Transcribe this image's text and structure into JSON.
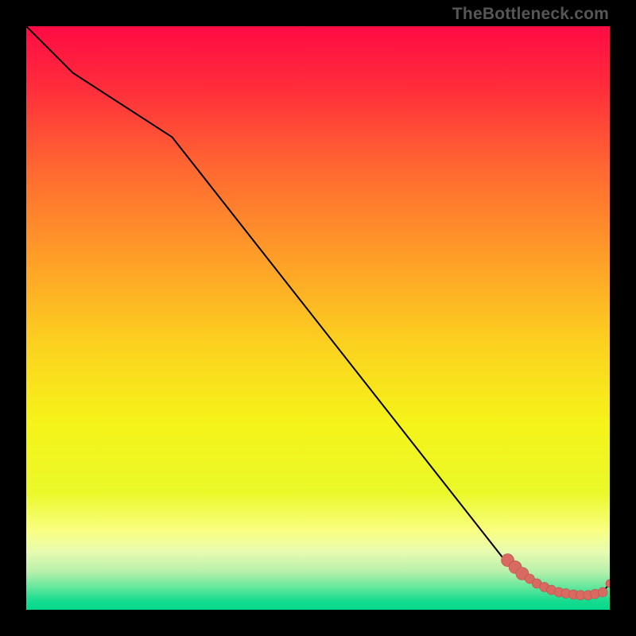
{
  "watermark": "TheBottleneck.com",
  "colors": {
    "line_main": "#000000",
    "marker_fill": "#d96a62",
    "marker_stroke": "#b85049",
    "black_border": "#000000"
  },
  "chart_data": {
    "type": "line",
    "title": "",
    "xlabel": "",
    "ylabel": "",
    "xlim": [
      0,
      100
    ],
    "ylim": [
      0,
      100
    ],
    "grid": false,
    "legend": false,
    "background": "red-yellow-green vertical gradient",
    "series": [
      {
        "name": "bottleneck-curve",
        "x": [
          0,
          8,
          25,
          82,
          85,
          87,
          89,
          91,
          93,
          95,
          97,
          99,
          100
        ],
        "y": [
          100,
          92,
          81,
          8.5,
          6.2,
          4.5,
          3.4,
          2.8,
          2.5,
          2.5,
          2.7,
          3.3,
          4.5
        ]
      }
    ],
    "markers": {
      "name": "highlighted-tail",
      "x": [
        82.5,
        83.8,
        85.0,
        86.3,
        87.5,
        88.8,
        90.0,
        91.3,
        92.5,
        93.8,
        95.0,
        96.3,
        97.5,
        98.8,
        100.0
      ],
      "y": [
        8.5,
        7.3,
        6.2,
        5.3,
        4.5,
        3.9,
        3.4,
        3.0,
        2.8,
        2.6,
        2.5,
        2.5,
        2.7,
        3.0,
        4.5
      ],
      "size": [
        8,
        8,
        8,
        6,
        6,
        6,
        6,
        6,
        6,
        6,
        6,
        6,
        6,
        6,
        5
      ]
    },
    "gradient_stops": [
      {
        "offset": 0.0,
        "color": "#ff0b44"
      },
      {
        "offset": 0.1,
        "color": "#ff2b3c"
      },
      {
        "offset": 0.25,
        "color": "#ff6a31"
      },
      {
        "offset": 0.4,
        "color": "#fe9f28"
      },
      {
        "offset": 0.55,
        "color": "#fbd31f"
      },
      {
        "offset": 0.68,
        "color": "#f5f319"
      },
      {
        "offset": 0.8,
        "color": "#eaf82a"
      },
      {
        "offset": 0.865,
        "color": "#f9ff82"
      },
      {
        "offset": 0.9,
        "color": "#e8fbb0"
      },
      {
        "offset": 0.935,
        "color": "#b7f0ab"
      },
      {
        "offset": 0.965,
        "color": "#58e59a"
      },
      {
        "offset": 0.985,
        "color": "#15db8f"
      },
      {
        "offset": 1.0,
        "color": "#06d98d"
      }
    ]
  }
}
